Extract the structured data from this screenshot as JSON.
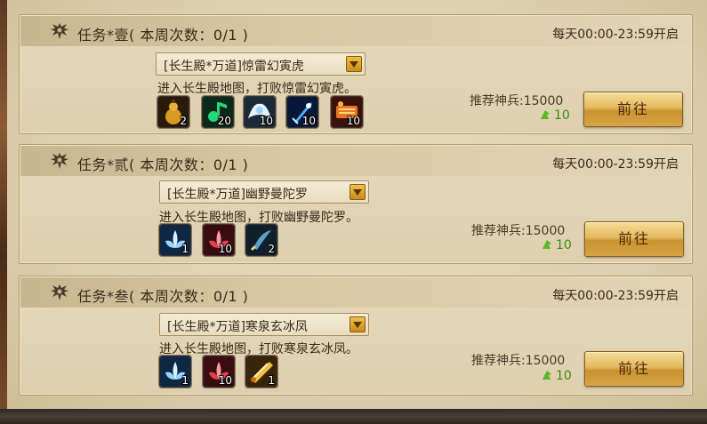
{
  "tasks": [
    {
      "title": "任务*壹( 本周次数：0/1 )",
      "schedule": "每天00:00-23:59开启",
      "dropdown": "[长生殿*万道]惊雷幻寅虎",
      "description": "进入长生殿地图，打败惊雷幻寅虎。",
      "recommend": "推荐神兵:15000",
      "power": "10",
      "button": "前往",
      "rewards": [
        {
          "icon": "gourd-icon",
          "count": "2"
        },
        {
          "icon": "green-note-icon",
          "count": "20"
        },
        {
          "icon": "white-wing-icon",
          "count": "10"
        },
        {
          "icon": "blue-sword-icon",
          "count": "10"
        },
        {
          "icon": "fire-scroll-icon",
          "count": "10"
        }
      ]
    },
    {
      "title": "任务*贰( 本周次数：0/1 )",
      "schedule": "每天00:00-23:59开启",
      "dropdown": "[长生殿*万道]幽野曼陀罗",
      "description": "进入长生殿地图，打败幽野曼陀罗。",
      "recommend": "推荐神兵:15000",
      "power": "10",
      "button": "前往",
      "rewards": [
        {
          "icon": "blue-lotus-icon",
          "count": "1"
        },
        {
          "icon": "red-lotus-icon",
          "count": "10"
        },
        {
          "icon": "dark-blade-icon",
          "count": "2"
        }
      ]
    },
    {
      "title": "任务*叁( 本周次数：0/1 )",
      "schedule": "每天00:00-23:59开启",
      "dropdown": "[长生殿*万道]寒泉玄冰凤",
      "description": "进入长生殿地图，打败寒泉玄冰凤。",
      "recommend": "推荐神兵:15000",
      "power": "10",
      "button": "前往",
      "rewards": [
        {
          "icon": "blue-lotus-icon",
          "count": "1"
        },
        {
          "icon": "red-lotus-icon",
          "count": "10"
        },
        {
          "icon": "golden-scroll-icon",
          "count": "1"
        }
      ]
    }
  ]
}
